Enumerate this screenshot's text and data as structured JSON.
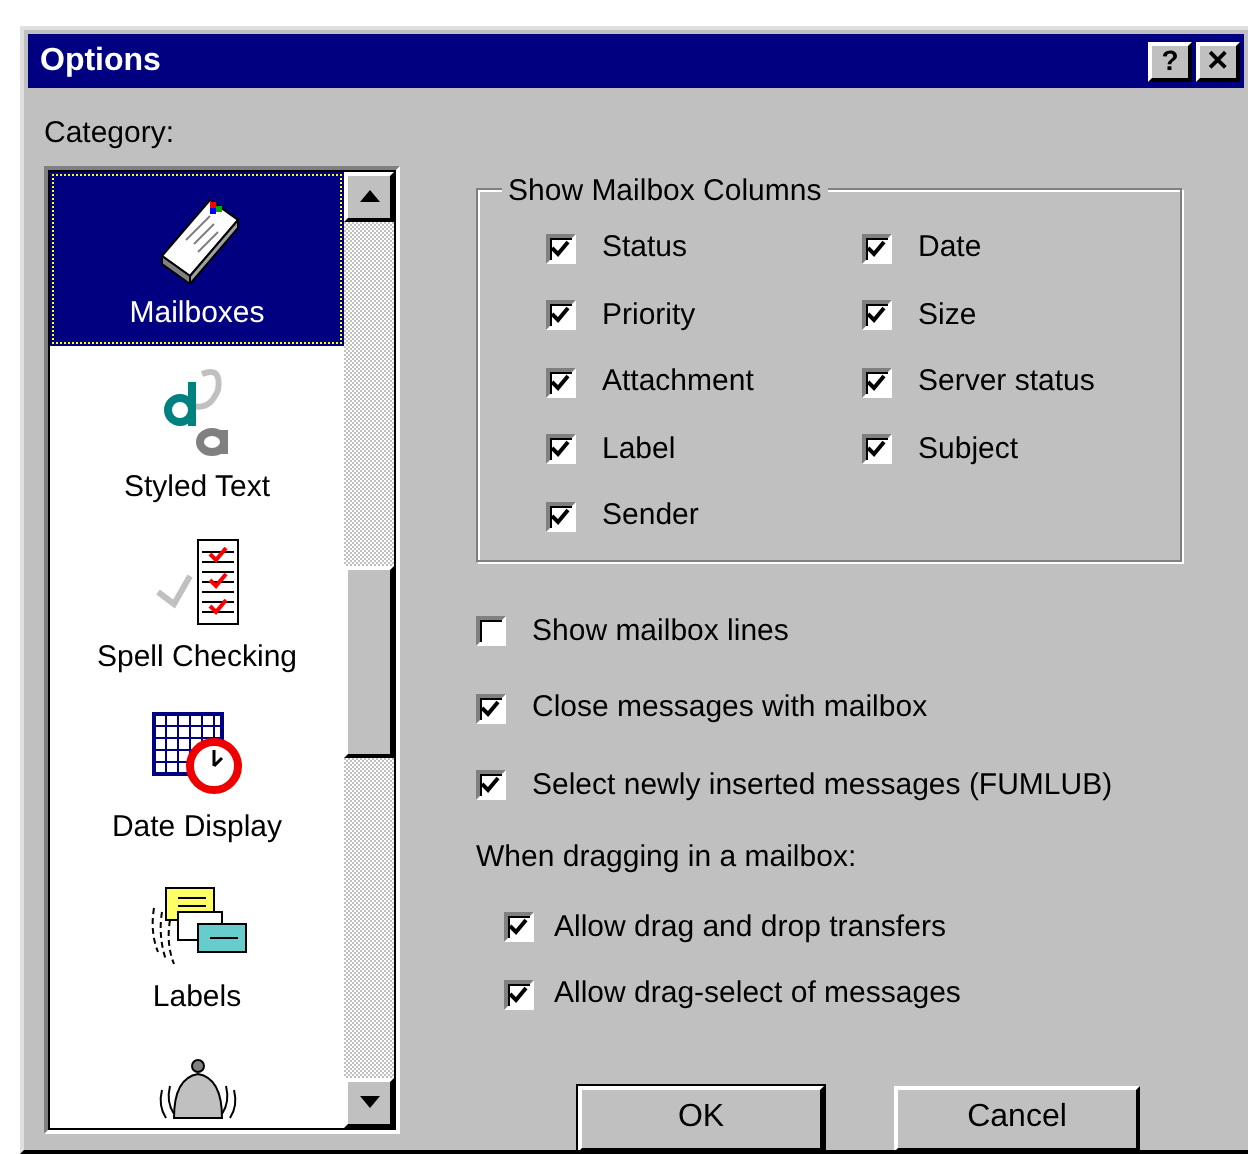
{
  "window": {
    "title": "Options",
    "help_button": "?",
    "close_button": "✕"
  },
  "category": {
    "label": "Category:",
    "items": [
      {
        "label": "Mailboxes",
        "kind": "mailbox",
        "selected": true
      },
      {
        "label": "Styled Text",
        "kind": "styled",
        "selected": false
      },
      {
        "label": "Spell Checking",
        "kind": "spell",
        "selected": false
      },
      {
        "label": "Date Display",
        "kind": "date",
        "selected": false
      },
      {
        "label": "Labels",
        "kind": "labels",
        "selected": false
      },
      {
        "kind": "bell",
        "selected": false
      }
    ]
  },
  "columns_group": {
    "title": "Show Mailbox Columns",
    "columns": [
      [
        {
          "label": "Status",
          "checked": true
        },
        {
          "label": "Priority",
          "checked": true
        },
        {
          "label": "Attachment",
          "checked": true
        },
        {
          "label": "Label",
          "checked": true
        },
        {
          "label": "Sender",
          "checked": true
        }
      ],
      [
        {
          "label": "Date",
          "checked": true
        },
        {
          "label": "Size",
          "checked": true
        },
        {
          "label": "Server status",
          "checked": true
        },
        {
          "label": "Subject",
          "checked": true
        }
      ]
    ]
  },
  "options": [
    {
      "label": "Show mailbox lines",
      "checked": false
    },
    {
      "label": "Close messages with mailbox",
      "checked": true
    },
    {
      "label": "Select newly inserted messages (FUMLUB)",
      "checked": true
    }
  ],
  "drag_group": {
    "label": "When dragging in a mailbox:",
    "options": [
      {
        "label": "Allow drag and drop transfers",
        "checked": true
      },
      {
        "label": "Allow drag-select of messages",
        "checked": true
      }
    ]
  },
  "buttons": [
    {
      "label": "OK",
      "default": true
    },
    {
      "label": "Cancel",
      "default": false
    }
  ]
}
